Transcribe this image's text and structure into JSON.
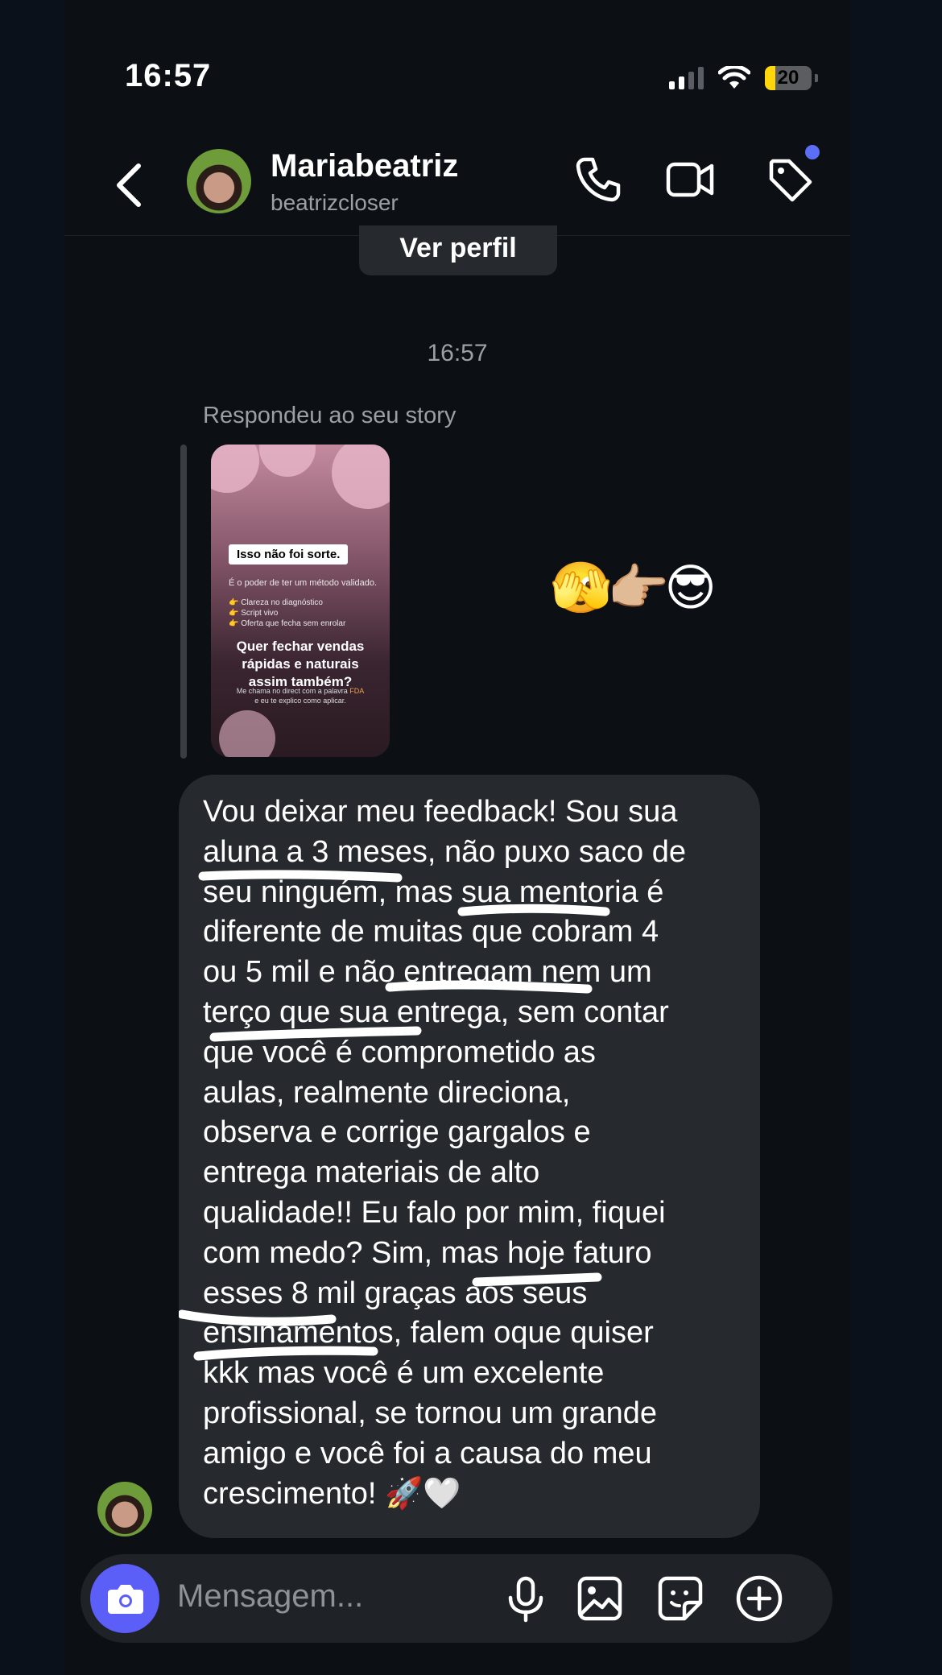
{
  "status": {
    "time": "16:57",
    "battery": "20"
  },
  "header": {
    "name": "Mariabeatriz",
    "handle": "beatrizcloser"
  },
  "ver_perfil": "Ver perfil",
  "timestamp": "16:57",
  "replied_label": "Respondeu ao seu story",
  "story": {
    "label": "Isso não foi sorte.",
    "subtitle": "É o poder de ter um método validado.",
    "items": [
      "👉 Clareza no diagnóstico",
      "👉 Script vivo",
      "👉 Oferta que fecha sem enrolar"
    ],
    "question": "Quer fechar vendas rápidas e naturais assim também?",
    "footer_a": "Me chama no direct com a palavra ",
    "footer_keyword": "FDA",
    "footer_b": "e eu te explico como aplicar."
  },
  "reaction_emojis": "🫣👉🏼😎",
  "message": "Vou deixar meu feedback! Sou sua\naluna a 3 meses, não puxo saco de\nseu ninguém, mas sua mentoria é\ndiferente de muitas que cobram 4\nou 5 mil e não entregam nem um\nterço que sua entrega, sem contar\nque você é comprometido as\naulas, realmente direciona,\nobserva e corrige gargalos e\nentrega materiais de alto\nqualidade!! Eu falo por mim, fiquei\ncom medo? Sim, mas hoje faturo\nesses 8 mil graças aos seus\nensinamentos, falem oque quiser\nkkk mas você é um excelente\nprofissional, se tornou um grande\namigo e você foi a causa do meu\ncrescimento! 🚀🤍",
  "composer": {
    "placeholder": "Mensagem..."
  },
  "colors": {
    "accent": "#5b5ef7",
    "bubble": "#26292e",
    "background": "#0c1014"
  }
}
